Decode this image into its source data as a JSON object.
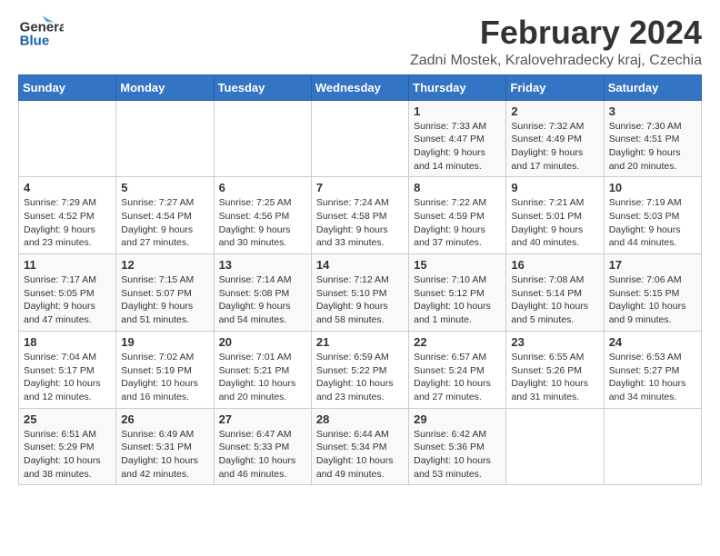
{
  "header": {
    "logo_line1": "General",
    "logo_line2": "Blue",
    "main_title": "February 2024",
    "subtitle": "Zadni Mostek, Kralovehradecky kraj, Czechia"
  },
  "calendar": {
    "days_of_week": [
      "Sunday",
      "Monday",
      "Tuesday",
      "Wednesday",
      "Thursday",
      "Friday",
      "Saturday"
    ],
    "weeks": [
      [
        {
          "day": "",
          "detail": ""
        },
        {
          "day": "",
          "detail": ""
        },
        {
          "day": "",
          "detail": ""
        },
        {
          "day": "",
          "detail": ""
        },
        {
          "day": "1",
          "detail": "Sunrise: 7:33 AM\nSunset: 4:47 PM\nDaylight: 9 hours\nand 14 minutes."
        },
        {
          "day": "2",
          "detail": "Sunrise: 7:32 AM\nSunset: 4:49 PM\nDaylight: 9 hours\nand 17 minutes."
        },
        {
          "day": "3",
          "detail": "Sunrise: 7:30 AM\nSunset: 4:51 PM\nDaylight: 9 hours\nand 20 minutes."
        }
      ],
      [
        {
          "day": "4",
          "detail": "Sunrise: 7:29 AM\nSunset: 4:52 PM\nDaylight: 9 hours\nand 23 minutes."
        },
        {
          "day": "5",
          "detail": "Sunrise: 7:27 AM\nSunset: 4:54 PM\nDaylight: 9 hours\nand 27 minutes."
        },
        {
          "day": "6",
          "detail": "Sunrise: 7:25 AM\nSunset: 4:56 PM\nDaylight: 9 hours\nand 30 minutes."
        },
        {
          "day": "7",
          "detail": "Sunrise: 7:24 AM\nSunset: 4:58 PM\nDaylight: 9 hours\nand 33 minutes."
        },
        {
          "day": "8",
          "detail": "Sunrise: 7:22 AM\nSunset: 4:59 PM\nDaylight: 9 hours\nand 37 minutes."
        },
        {
          "day": "9",
          "detail": "Sunrise: 7:21 AM\nSunset: 5:01 PM\nDaylight: 9 hours\nand 40 minutes."
        },
        {
          "day": "10",
          "detail": "Sunrise: 7:19 AM\nSunset: 5:03 PM\nDaylight: 9 hours\nand 44 minutes."
        }
      ],
      [
        {
          "day": "11",
          "detail": "Sunrise: 7:17 AM\nSunset: 5:05 PM\nDaylight: 9 hours\nand 47 minutes."
        },
        {
          "day": "12",
          "detail": "Sunrise: 7:15 AM\nSunset: 5:07 PM\nDaylight: 9 hours\nand 51 minutes."
        },
        {
          "day": "13",
          "detail": "Sunrise: 7:14 AM\nSunset: 5:08 PM\nDaylight: 9 hours\nand 54 minutes."
        },
        {
          "day": "14",
          "detail": "Sunrise: 7:12 AM\nSunset: 5:10 PM\nDaylight: 9 hours\nand 58 minutes."
        },
        {
          "day": "15",
          "detail": "Sunrise: 7:10 AM\nSunset: 5:12 PM\nDaylight: 10 hours\nand 1 minute."
        },
        {
          "day": "16",
          "detail": "Sunrise: 7:08 AM\nSunset: 5:14 PM\nDaylight: 10 hours\nand 5 minutes."
        },
        {
          "day": "17",
          "detail": "Sunrise: 7:06 AM\nSunset: 5:15 PM\nDaylight: 10 hours\nand 9 minutes."
        }
      ],
      [
        {
          "day": "18",
          "detail": "Sunrise: 7:04 AM\nSunset: 5:17 PM\nDaylight: 10 hours\nand 12 minutes."
        },
        {
          "day": "19",
          "detail": "Sunrise: 7:02 AM\nSunset: 5:19 PM\nDaylight: 10 hours\nand 16 minutes."
        },
        {
          "day": "20",
          "detail": "Sunrise: 7:01 AM\nSunset: 5:21 PM\nDaylight: 10 hours\nand 20 minutes."
        },
        {
          "day": "21",
          "detail": "Sunrise: 6:59 AM\nSunset: 5:22 PM\nDaylight: 10 hours\nand 23 minutes."
        },
        {
          "day": "22",
          "detail": "Sunrise: 6:57 AM\nSunset: 5:24 PM\nDaylight: 10 hours\nand 27 minutes."
        },
        {
          "day": "23",
          "detail": "Sunrise: 6:55 AM\nSunset: 5:26 PM\nDaylight: 10 hours\nand 31 minutes."
        },
        {
          "day": "24",
          "detail": "Sunrise: 6:53 AM\nSunset: 5:27 PM\nDaylight: 10 hours\nand 34 minutes."
        }
      ],
      [
        {
          "day": "25",
          "detail": "Sunrise: 6:51 AM\nSunset: 5:29 PM\nDaylight: 10 hours\nand 38 minutes."
        },
        {
          "day": "26",
          "detail": "Sunrise: 6:49 AM\nSunset: 5:31 PM\nDaylight: 10 hours\nand 42 minutes."
        },
        {
          "day": "27",
          "detail": "Sunrise: 6:47 AM\nSunset: 5:33 PM\nDaylight: 10 hours\nand 46 minutes."
        },
        {
          "day": "28",
          "detail": "Sunrise: 6:44 AM\nSunset: 5:34 PM\nDaylight: 10 hours\nand 49 minutes."
        },
        {
          "day": "29",
          "detail": "Sunrise: 6:42 AM\nSunset: 5:36 PM\nDaylight: 10 hours\nand 53 minutes."
        },
        {
          "day": "",
          "detail": ""
        },
        {
          "day": "",
          "detail": ""
        }
      ]
    ]
  }
}
